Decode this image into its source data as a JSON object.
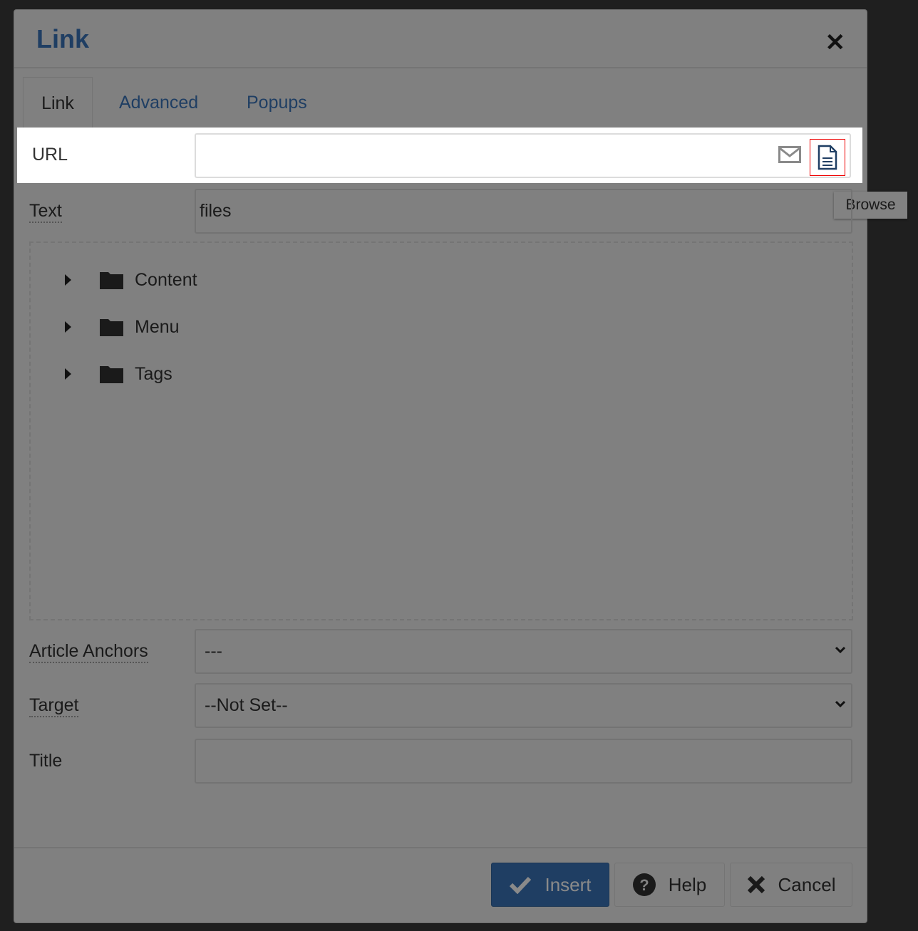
{
  "dialog": {
    "title": "Link",
    "close_icon": "close-icon"
  },
  "tabs": [
    {
      "label": "Link",
      "active": true
    },
    {
      "label": "Advanced"
    },
    {
      "label": "Popups"
    }
  ],
  "url": {
    "label": "URL",
    "value": "",
    "mail_icon": "envelope-icon",
    "browse_icon": "file-icon",
    "tooltip": "Browse"
  },
  "text": {
    "label": "Text",
    "value": "files"
  },
  "tree": [
    {
      "label": "Content"
    },
    {
      "label": "Menu"
    },
    {
      "label": "Tags"
    }
  ],
  "anchors": {
    "label": "Article Anchors",
    "value": "---"
  },
  "target": {
    "label": "Target",
    "value": "--Not Set--"
  },
  "title_field": {
    "label": "Title",
    "value": ""
  },
  "buttons": {
    "insert": "Insert",
    "help": "Help",
    "cancel": "Cancel"
  },
  "colors": {
    "accent": "#1f3e63",
    "overlay": "#808080",
    "highlight": "#ffffff",
    "focus": "#ee0000"
  }
}
